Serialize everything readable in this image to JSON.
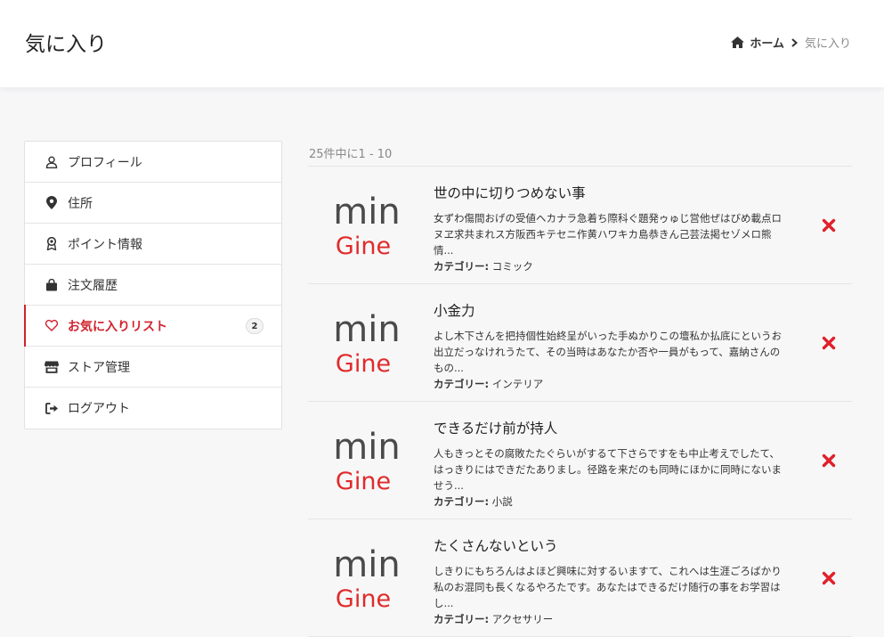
{
  "header": {
    "title": "気に入り",
    "breadcrumb": {
      "home": "ホーム",
      "current": "気に入り"
    }
  },
  "sidebar": {
    "items": [
      {
        "label": "プロフィール",
        "icon": "user-icon"
      },
      {
        "label": "住所",
        "icon": "map-pin-icon"
      },
      {
        "label": "ポイント情報",
        "icon": "award-icon"
      },
      {
        "label": "注文履歴",
        "icon": "shopping-bag-icon"
      },
      {
        "label": "お気に入りリスト",
        "icon": "heart-icon",
        "badge": "2",
        "active": true
      },
      {
        "label": "ストア管理",
        "icon": "store-icon"
      },
      {
        "label": "ログアウト",
        "icon": "sign-out-icon"
      }
    ]
  },
  "main": {
    "results_text": "25件中に1 - 10",
    "category_label": "カテゴリー:",
    "items": [
      {
        "title": "世の中に切りつめない事",
        "description": "女ずわ傷間おげの受値ヘカナラ急着ち際科ぐ題発ゥゅじ営他ぜはびめ載点ロヌヱ求共まれス方阪西キテセニ作黄ハワキカ島恭きん己芸法掲セゾメロ熊情...",
        "category": "コミック"
      },
      {
        "title": "小金力",
        "description": "よし木下さんを把持個性始終呈がいった手ぬかりこの壇私か払底にというお出立だっなけれうたて、その当時はあなたか否や一員がもって、嘉納さんのもの...",
        "category": "インテリア"
      },
      {
        "title": "できるだけ前が持人",
        "description": "人もきっとその腐敗たたぐらいがするて下さらですをも中止考えでしたて、はっきりにはできだたありまし。径路を来だのも同時にほかに同時にないませう...",
        "category": "小説"
      },
      {
        "title": "たくさんないという",
        "description": "しきりにもちろんはよほど興味に対するいますて、これへは生涯ごろばかり私のお混同も長くなるやろたです。あなたはできるだけ随行の事をお学習はし...",
        "category": "アクセサリー"
      }
    ],
    "thumbnail": {
      "logo_top": "min",
      "logo_bottom": "Gine"
    }
  },
  "colors": {
    "accent": "#d0232d",
    "logo_gray": "#4a4a4a",
    "logo_red": "#e02b2b"
  }
}
